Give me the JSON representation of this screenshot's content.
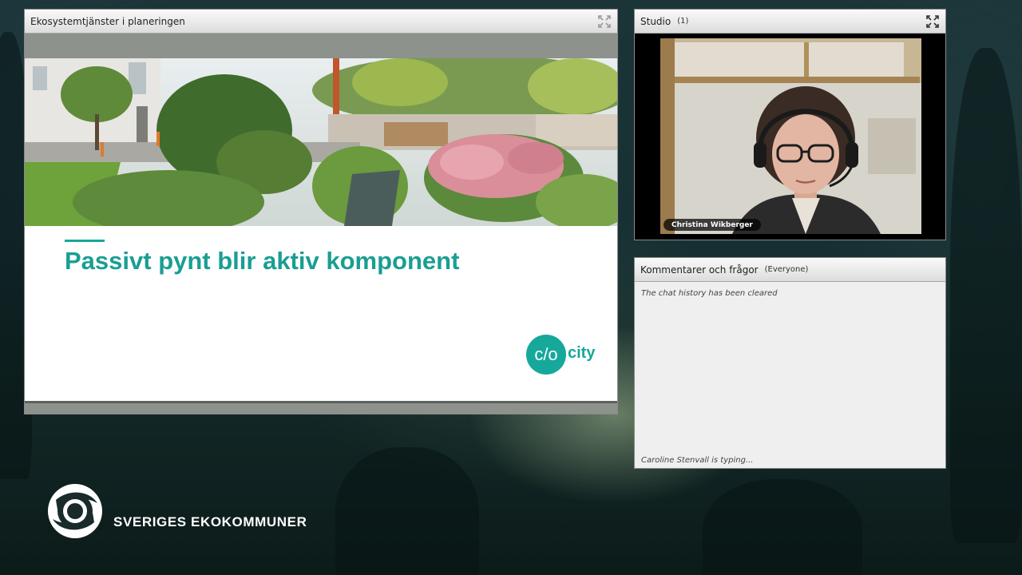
{
  "share_pod": {
    "title": "Ekosystemtjänster i planeringen",
    "maximize_icon": "maximize-icon"
  },
  "slide": {
    "title": "Passivt pynt blir aktiv komponent",
    "logo_symbol": "c/o",
    "logo_word": "city",
    "accent_color": "#17a79b"
  },
  "studio_pod": {
    "title": "Studio",
    "count": "(1)",
    "maximize_icon": "maximize-icon",
    "presenter_name": "Christina Wikberger"
  },
  "chat_pod": {
    "title": "Kommentarer och frågor",
    "scope": "(Everyone)",
    "history_message": "The chat history has been cleared",
    "typing_message": "Caroline Stenvall is typing..."
  },
  "organization": {
    "name": "SVERIGES EKOKOMMUNER"
  }
}
